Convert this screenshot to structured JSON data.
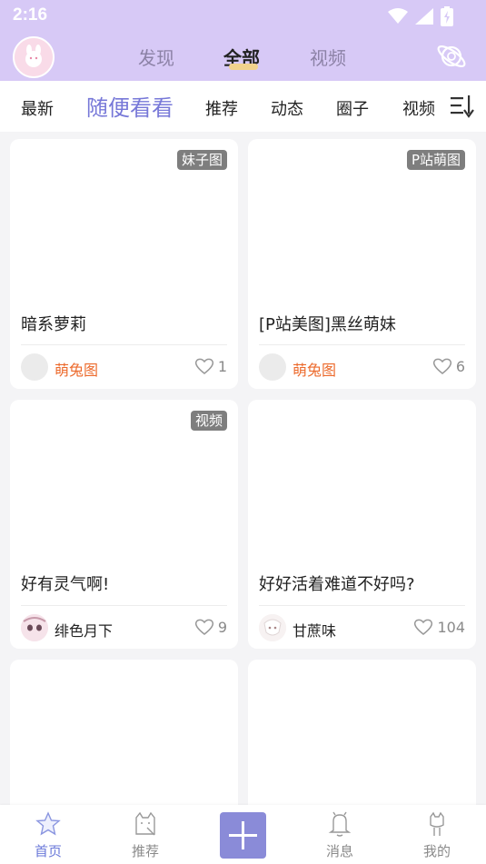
{
  "status_bar": {
    "time": "2:16"
  },
  "top_tabs": [
    {
      "label": "发现",
      "active": false
    },
    {
      "label": "全部",
      "active": true
    },
    {
      "label": "视频",
      "active": false
    }
  ],
  "categories": [
    {
      "label": "最新",
      "active": false
    },
    {
      "label": "随便看看",
      "active": true
    },
    {
      "label": "推荐",
      "active": false
    },
    {
      "label": "动态",
      "active": false
    },
    {
      "label": "圈子",
      "active": false
    },
    {
      "label": "视频",
      "active": false
    }
  ],
  "cards": [
    {
      "badge": "妹子图",
      "title": "暗系萝莉",
      "author": "萌兔图",
      "likes": "1"
    },
    {
      "badge": "P站萌图",
      "title": "[P站美图]黑丝萌妹",
      "author": "萌兔图",
      "likes": "6"
    },
    {
      "badge": "视频",
      "title": "好有灵气啊!",
      "author": "绯色月下",
      "likes": "9"
    },
    {
      "badge": "",
      "title": "好好活着难道不好吗?",
      "author": "甘蔗味",
      "likes": "104"
    },
    {
      "badge": "",
      "title": "",
      "author": "",
      "likes": ""
    },
    {
      "badge": "",
      "title": "",
      "author": "",
      "likes": ""
    }
  ],
  "bottom_nav": [
    {
      "label": "首页",
      "icon": "star-icon",
      "active": true
    },
    {
      "label": "推荐",
      "icon": "cat-icon",
      "active": false
    },
    {
      "label": "",
      "icon": "plus-icon",
      "active": false
    },
    {
      "label": "消息",
      "icon": "bell-icon",
      "active": false
    },
    {
      "label": "我的",
      "icon": "person-icon",
      "active": false
    }
  ],
  "colors": {
    "header_bg": "#d7c9f6",
    "accent": "#7778d8",
    "author_orange": "#ec6a2c",
    "add_button": "#8a8bd8"
  }
}
